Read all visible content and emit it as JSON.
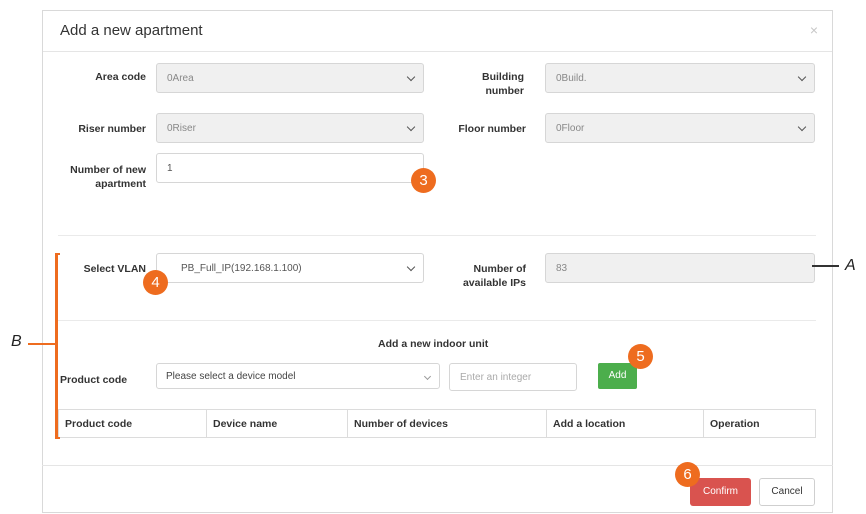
{
  "dialog": {
    "title": "Add a new apartment",
    "close_glyph": "×"
  },
  "form": {
    "area_code": {
      "label": "Area code",
      "value": "0Area"
    },
    "building_number": {
      "label": "Building number",
      "value": "0Build."
    },
    "riser_number": {
      "label": "Riser number",
      "value": "0Riser"
    },
    "floor_number": {
      "label": "Floor number",
      "value": "0Floor"
    },
    "number_of_new_apartment": {
      "label": "Number of new apartment",
      "value": "1"
    },
    "select_vlan": {
      "label": "Select VLAN",
      "value": "PB_Full_IP(192.168.1.100)"
    },
    "available_ips": {
      "label": "Number of available IPs",
      "value": "83"
    }
  },
  "indoor_unit": {
    "title": "Add a new indoor unit",
    "product_code_label": "Product code",
    "product_code_placeholder": "Please select a device model",
    "integer_placeholder": "Enter an integer",
    "add_label": "Add"
  },
  "table": {
    "headers": [
      "Product code",
      "Device name",
      "Number of devices",
      "Add a location",
      "Operation"
    ]
  },
  "footer": {
    "confirm_label": "Confirm",
    "cancel_label": "Cancel"
  },
  "annotations": {
    "badges": [
      "3",
      "4",
      "5",
      "6"
    ],
    "letter_a": "A",
    "letter_b": "B",
    "accent_color": "#ee6c1f"
  },
  "colors": {
    "confirm": "#d9534f",
    "add": "#4cae4c"
  }
}
